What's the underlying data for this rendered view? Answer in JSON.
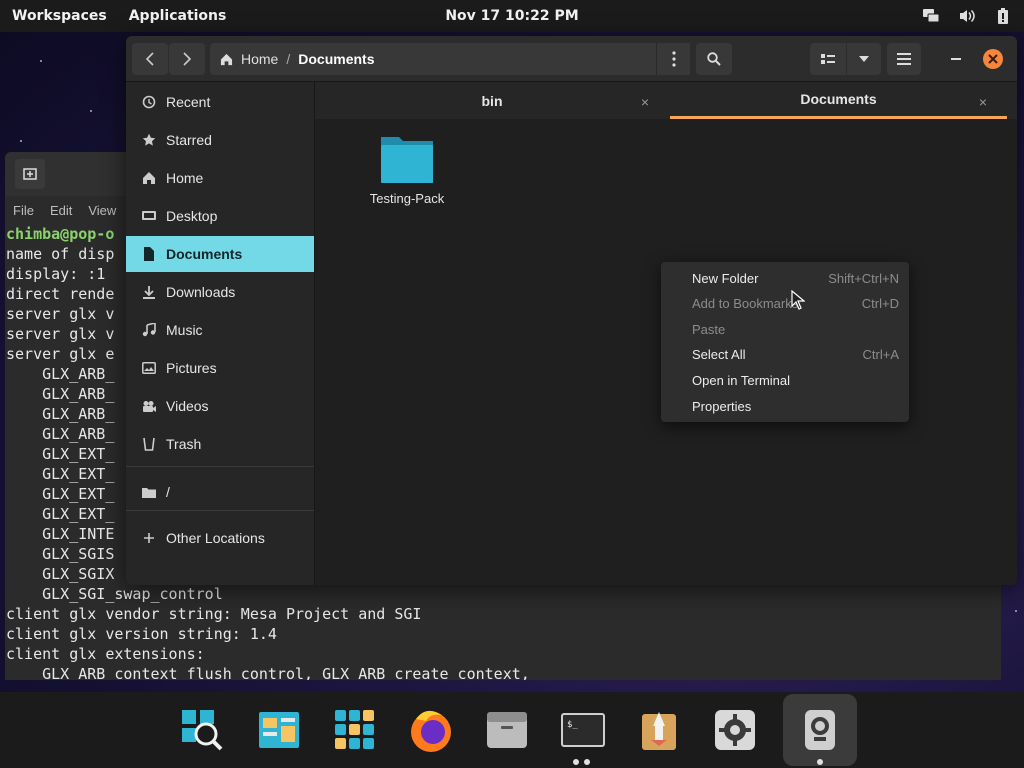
{
  "topbar": {
    "workspaces": "Workspaces",
    "applications": "Applications",
    "clock": "Nov 17  10:22 PM",
    "icons": [
      "display-icon",
      "volume-icon",
      "battery-icon"
    ]
  },
  "terminal": {
    "menu": [
      "File",
      "Edit",
      "View"
    ],
    "lines": [
      "chimba@pop-o",
      "name of disp",
      "display: :1",
      "direct rende",
      "server glx v",
      "server glx v",
      "server glx e",
      "    GLX_ARB_",
      "    GLX_ARB_",
      "    GLX_ARB_",
      "    GLX_ARB_",
      "    GLX_EXT_",
      "    GLX_EXT_",
      "    GLX_EXT_",
      "    GLX_EXT_",
      "    GLX_INTE",
      "    GLX_SGIS",
      "    GLX_SGIX",
      "    GLX_SGI_swap_control",
      "client glx vendor string: Mesa Project and SGI",
      "client glx version string: 1.4",
      "client glx extensions:",
      "    GLX_ARB_context_flush_control, GLX_ARB_create_context,"
    ]
  },
  "filemanager": {
    "path": {
      "home": "Home",
      "separator": "/",
      "current": "Documents"
    },
    "sidebar": [
      {
        "label": "Recent",
        "icon": "clock-icon"
      },
      {
        "label": "Starred",
        "icon": "star-icon"
      },
      {
        "label": "Home",
        "icon": "home-icon"
      },
      {
        "label": "Desktop",
        "icon": "desktop-icon"
      },
      {
        "label": "Documents",
        "icon": "document-icon",
        "active": true
      },
      {
        "label": "Downloads",
        "icon": "download-icon"
      },
      {
        "label": "Music",
        "icon": "music-icon"
      },
      {
        "label": "Pictures",
        "icon": "pictures-icon"
      },
      {
        "label": "Videos",
        "icon": "videos-icon"
      },
      {
        "label": "Trash",
        "icon": "trash-icon"
      },
      {
        "label": "/",
        "icon": "drive-icon"
      },
      {
        "label": "Other Locations",
        "icon": "plus-icon"
      }
    ],
    "tabs": [
      {
        "label": "bin",
        "close": "×"
      },
      {
        "label": "Documents",
        "close": "×",
        "active": true
      }
    ],
    "items": [
      {
        "label": "Testing-Pack",
        "icon": "folder-icon",
        "color": "#2fa9c7"
      }
    ]
  },
  "context_menu": {
    "items": [
      {
        "label": "New Folder",
        "shortcut": "Shift+Ctrl+N",
        "enabled": true
      },
      {
        "label": "Add to Bookmarks",
        "shortcut": "Ctrl+D",
        "enabled": false
      },
      {
        "label": "Paste",
        "shortcut": "",
        "enabled": false
      },
      {
        "label": "Select All",
        "shortcut": "Ctrl+A",
        "enabled": true
      },
      {
        "label": "Open in Terminal",
        "shortcut": "",
        "enabled": true
      },
      {
        "label": "Properties",
        "shortcut": "",
        "enabled": true
      }
    ]
  },
  "dock": {
    "apps": [
      "pop-shop-icon",
      "files-icon",
      "app-grid-icon",
      "firefox-icon",
      "file-manager-icon",
      "terminal-icon",
      "installer-icon",
      "settings-icon",
      "screenshot-icon"
    ]
  },
  "colors": {
    "accent": "#73d9e6",
    "tab_underline": "#f5a65b",
    "close_button": "#f5863c",
    "prompt": "#8ad46b"
  }
}
